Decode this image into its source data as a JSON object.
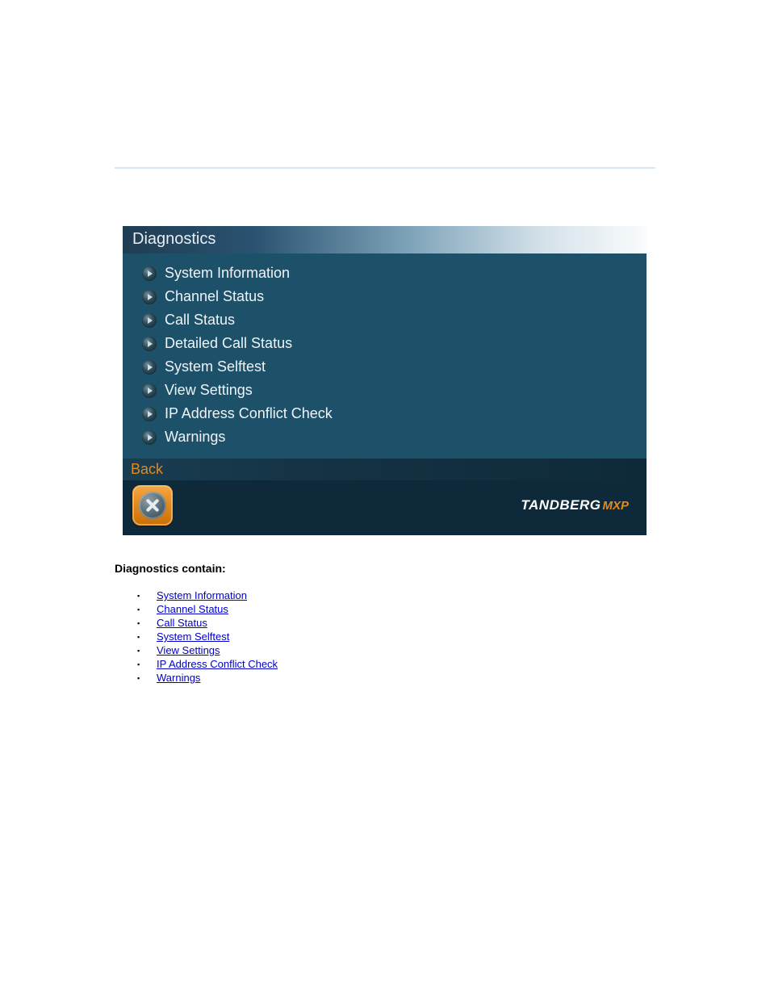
{
  "menu": {
    "title": "Diagnostics",
    "items": [
      {
        "label": "System Information"
      },
      {
        "label": "Channel Status"
      },
      {
        "label": "Call Status"
      },
      {
        "label": "Detailed Call Status"
      },
      {
        "label": "System Selftest"
      },
      {
        "label": "View Settings"
      },
      {
        "label": "IP Address Conflict Check"
      },
      {
        "label": "Warnings"
      }
    ],
    "back_label": "Back"
  },
  "brand": {
    "name": "TANDBERG",
    "suffix": "MXP"
  },
  "diagnostics": {
    "heading": "Diagnostics contain:",
    "links": [
      {
        "label": "System Information"
      },
      {
        "label": "Channel Status"
      },
      {
        "label": "Call Status"
      },
      {
        "label": "System Selftest"
      },
      {
        "label": "View Settings"
      },
      {
        "label": "IP Address Conflict Check"
      },
      {
        "label": "Warnings"
      }
    ]
  }
}
